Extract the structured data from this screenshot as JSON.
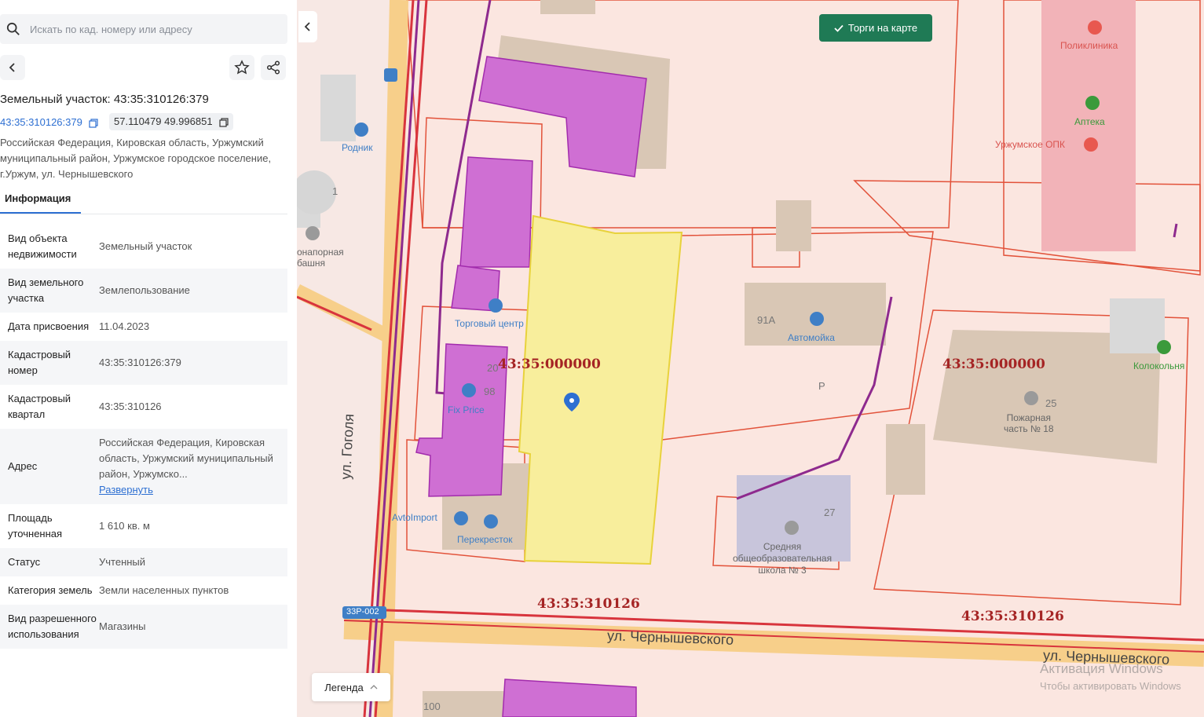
{
  "search": {
    "placeholder": "Искать по кад. номеру или адресу"
  },
  "object": {
    "title": "Земельный участок: 43:35:310126:379",
    "cad_number": "43:35:310126:379",
    "coords": "57.110479 49.996851",
    "address": "Российская Федерация, Кировская область, Уржумский муниципальный район, Уржумское городское поселение, г.Уржум, ул. Чернышевского"
  },
  "tabs": {
    "info": "Информация"
  },
  "props": [
    {
      "label": "Вид объекта недвижимости",
      "value": "Земельный участок"
    },
    {
      "label": "Вид земельного участка",
      "value": "Землепользование"
    },
    {
      "label": "Дата присвоения",
      "value": "11.04.2023"
    },
    {
      "label": "Кадастровый номер",
      "value": "43:35:310126:379"
    },
    {
      "label": "Кадастровый квартал",
      "value": "43:35:310126"
    },
    {
      "label": "Адрес",
      "value": "Российская Федерация, Кировская область, Уржумский муниципальный район, Уржумско...",
      "link": "Развернуть"
    },
    {
      "label": "Площадь уточненная",
      "value": "1 610 кв. м"
    },
    {
      "label": "Статус",
      "value": "Учтенный"
    },
    {
      "label": "Категория земель",
      "value": "Земли населенных пунктов"
    },
    {
      "label": "Вид разрешенного использования",
      "value": "Магазины"
    }
  ],
  "map": {
    "auction_button": "Торги на карте",
    "legend_button": "Легенда",
    "labels": {
      "rodnik": "Родник",
      "tower": "онапорная\nбашня",
      "trade_center": "Торговый центр",
      "fix_price": "Fix Price",
      "avtoimport": "AvtoImport",
      "perekrestok": "Перекресток",
      "avtomoyka": "Автомойка",
      "polyclinic": "Поликлиника",
      "pharmacy": "Аптека",
      "opk": "Уржумское ОПК",
      "bell_tower": "Колокольня",
      "fire_station": "Пожарная\nчасть № 18",
      "school": "Средняя\nобщеобразовательная\nшкола № 3",
      "street_gogolya": "ул. Гоголя",
      "street_chern1": "ул. Чернышевского",
      "street_chern2": "ул. Чернышевского",
      "road_code": "33Р-002",
      "parking": "Р"
    },
    "quarters": {
      "q1": "43:35:000000",
      "q2": "43:35:000000",
      "q3": "43:35:310126",
      "q4": "43:35:310126"
    },
    "numbers": {
      "n1": "1",
      "n91a": "91А",
      "n20": "20",
      "n98": "98",
      "n25": "25",
      "n27": "27",
      "n100": "100"
    },
    "watermark": {
      "line1": "Активация Windows",
      "line2": "Чтобы активировать Windows"
    }
  }
}
